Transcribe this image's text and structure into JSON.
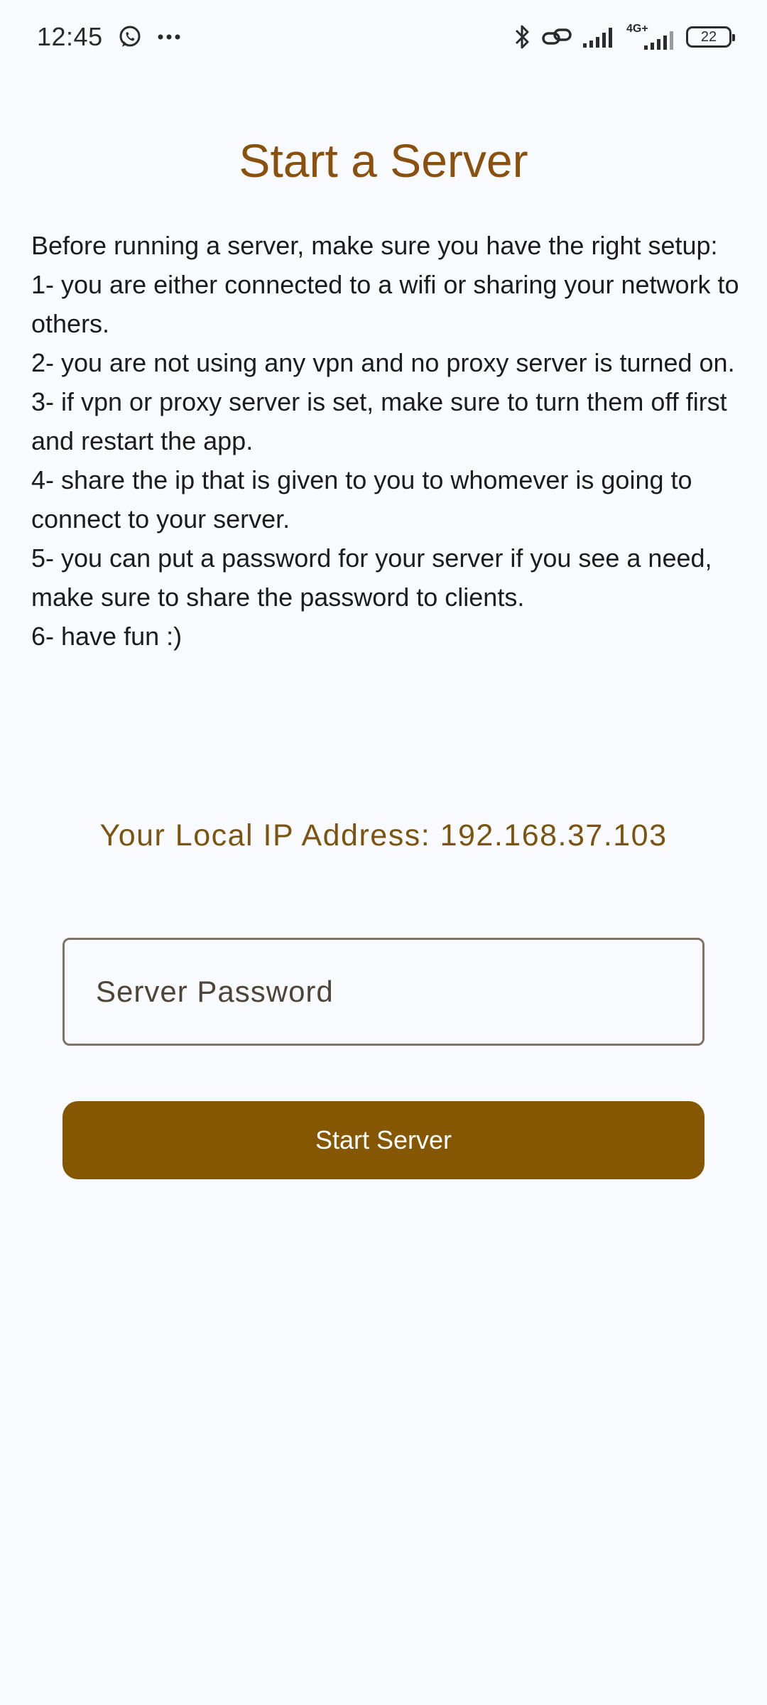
{
  "status_bar": {
    "time": "12:45",
    "left_icons": [
      "whatsapp-icon",
      "more-dots-icon"
    ],
    "right_icons": [
      "bluetooth-icon",
      "link-icon",
      "signal-icon",
      "signal-4g-icon",
      "battery-icon"
    ],
    "network_type": "4G+",
    "battery_level": "22"
  },
  "page": {
    "title": "Start a Server",
    "instructions": [
      "Before running a server, make sure you have the right setup:",
      "1- you are either connected to a wifi or sharing your network to others.",
      "2- you are not using any vpn and no proxy server is turned on.",
      "3- if vpn or proxy server is set, make sure to turn them off first and restart the app.",
      "4- share the ip that is given to you to whomever is going to connect to your server.",
      "5- you can put a password for your server if you see a need, make sure to share the password to clients.",
      "6- have fun :)"
    ],
    "ip_label": "Your Local IP Address: 192.168.37.103",
    "password_placeholder": "Server Password",
    "password_value": "",
    "start_button_label": "Start Server"
  },
  "colors": {
    "background": "#f9fafe",
    "title": "#8a500e",
    "ip_text": "#7a5410",
    "button": "#855703",
    "field_border": "#7f7366"
  }
}
